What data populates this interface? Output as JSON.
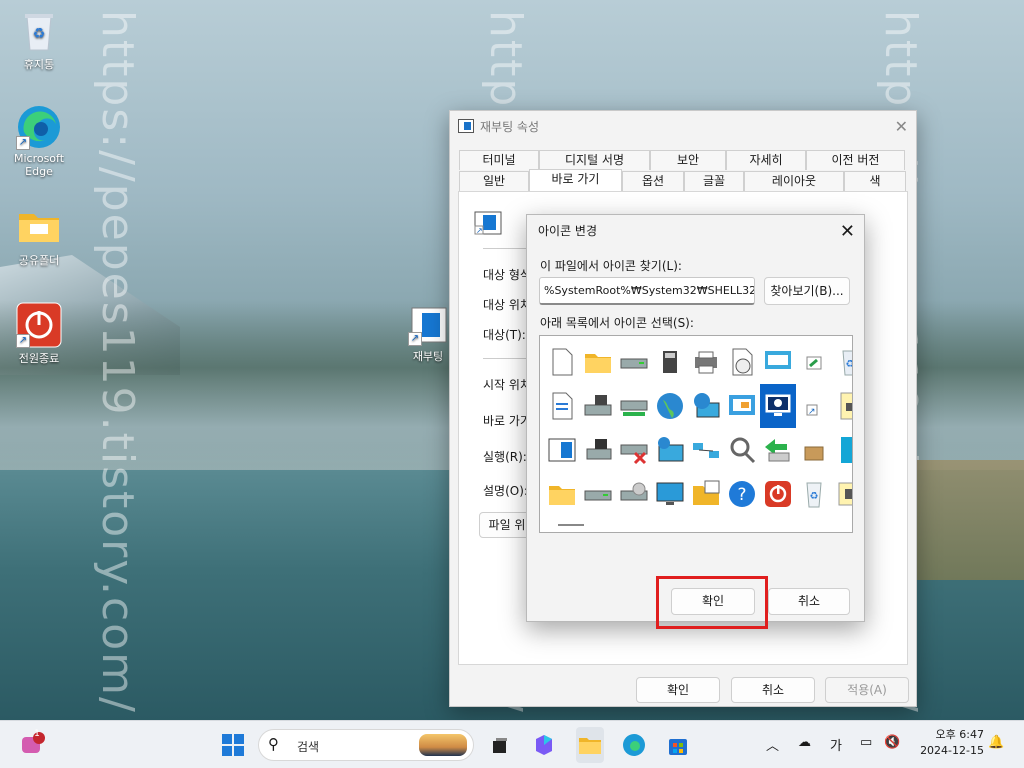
{
  "desktop": {
    "watermark": "https://pepes119.tistory.com/",
    "icons": [
      {
        "label": "휴지통"
      },
      {
        "label": "Microsoft Edge"
      },
      {
        "label": "공유폴더"
      },
      {
        "label": "전원종료"
      },
      {
        "label": "재부팅"
      }
    ]
  },
  "properties": {
    "title": "재부팅 속성",
    "tabs_row1": [
      "터미널",
      "디지털 서명",
      "보안",
      "자세히",
      "이전 버전"
    ],
    "tabs_row2": [
      "일반",
      "바로 가기",
      "옵션",
      "글꼴",
      "레이아웃",
      "색"
    ],
    "active_tab": "바로 가기",
    "fields": [
      "대상 형식:",
      "대상 위치:",
      "대상(T):",
      "시작 위치(",
      "바로 가기",
      "실행(R):",
      "설명(O):"
    ],
    "open_file_button": "파일 위",
    "ok": "확인",
    "cancel": "취소",
    "apply": "적용(A)"
  },
  "change_icon": {
    "title": "아이콘 변경",
    "search_label": "이 파일에서 아이콘 찾기(L):",
    "path_value": "%SystemRoot%₩System32₩SHELL32.d",
    "browse": "찾아보기(B)...",
    "list_label": "아래 목록에서 아이콘 선택(S):",
    "ok": "확인",
    "cancel": "취소",
    "icons": [
      "document-icon",
      "folder-icon",
      "drive-icon",
      "chip-icon",
      "printer-icon",
      "clock-document-icon",
      "monitor-window-icon",
      "shortcut-window-icon",
      "recycle-full-icon",
      "text-document-icon",
      "floppy-drive-icon",
      "network-drive-icon",
      "globe-icon",
      "globe-monitor-icon",
      "control-panel-icon",
      "power-monitor-icon",
      "shortcut-arrow-icon",
      "key-document-icon",
      "window-icon",
      "floppy-icon",
      "drive-error-icon",
      "network-monitor-icon",
      "network-icon",
      "search-icon",
      "usb-arrow-icon",
      "box-icon",
      "cyan-block-icon",
      "folder-icon",
      "drive-icon",
      "cd-drive-icon",
      "monitor-icon",
      "grid-folder-icon",
      "help-icon",
      "power-icon",
      "recycle-empty-icon",
      "key-folder-icon"
    ],
    "selected_index": 16
  },
  "taskbar": {
    "search_placeholder": "검색",
    "notification_count": "1",
    "ime": "가",
    "time": "오후 6:47",
    "date": "2024-12-15"
  }
}
